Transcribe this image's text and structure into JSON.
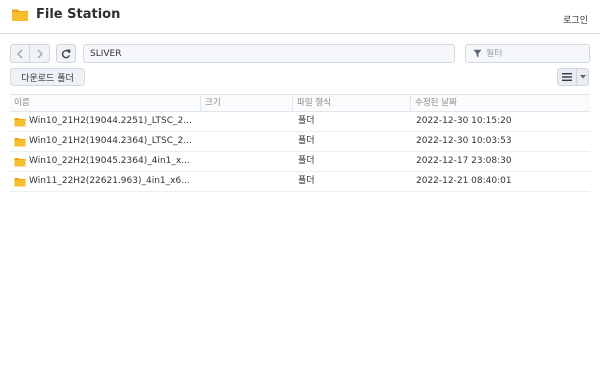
{
  "app": {
    "title": "File Station",
    "login_label": "로그인"
  },
  "toolbar": {
    "path": "SLIVER",
    "filter_placeholder": "필터",
    "download_folder_label": "다운로드 폴더"
  },
  "table": {
    "headers": {
      "name": "이름",
      "size": "크기",
      "type": "파일 형식",
      "modified": "수정된 날짜"
    },
    "rows": [
      {
        "name": "Win10_21H2(19044.2251)_LTSC_2...",
        "size": "",
        "type": "폴더",
        "modified": "2022-12-30 10:15:20"
      },
      {
        "name": "Win10_21H2(19044.2364)_LTSC_2...",
        "size": "",
        "type": "폴더",
        "modified": "2022-12-30 10:03:53"
      },
      {
        "name": "Win10_22H2(19045.2364)_4in1_x...",
        "size": "",
        "type": "폴더",
        "modified": "2022-12-17 23:08:30"
      },
      {
        "name": "Win11_22H2(22621.963)_4in1_x6...",
        "size": "",
        "type": "폴더",
        "modified": "2022-12-21 08:40:01"
      }
    ]
  },
  "icons": {
    "app": "folder-icon",
    "back": "chevron-left-icon",
    "forward": "chevron-right-icon",
    "refresh": "refresh-icon",
    "filter": "funnel-icon",
    "view": "list-view-icon",
    "view_dropdown": "caret-down-icon",
    "row": "folder-icon"
  },
  "colors": {
    "folder": "#f5b422",
    "border": "#d2d9e0",
    "accent": "#2b2f33"
  }
}
